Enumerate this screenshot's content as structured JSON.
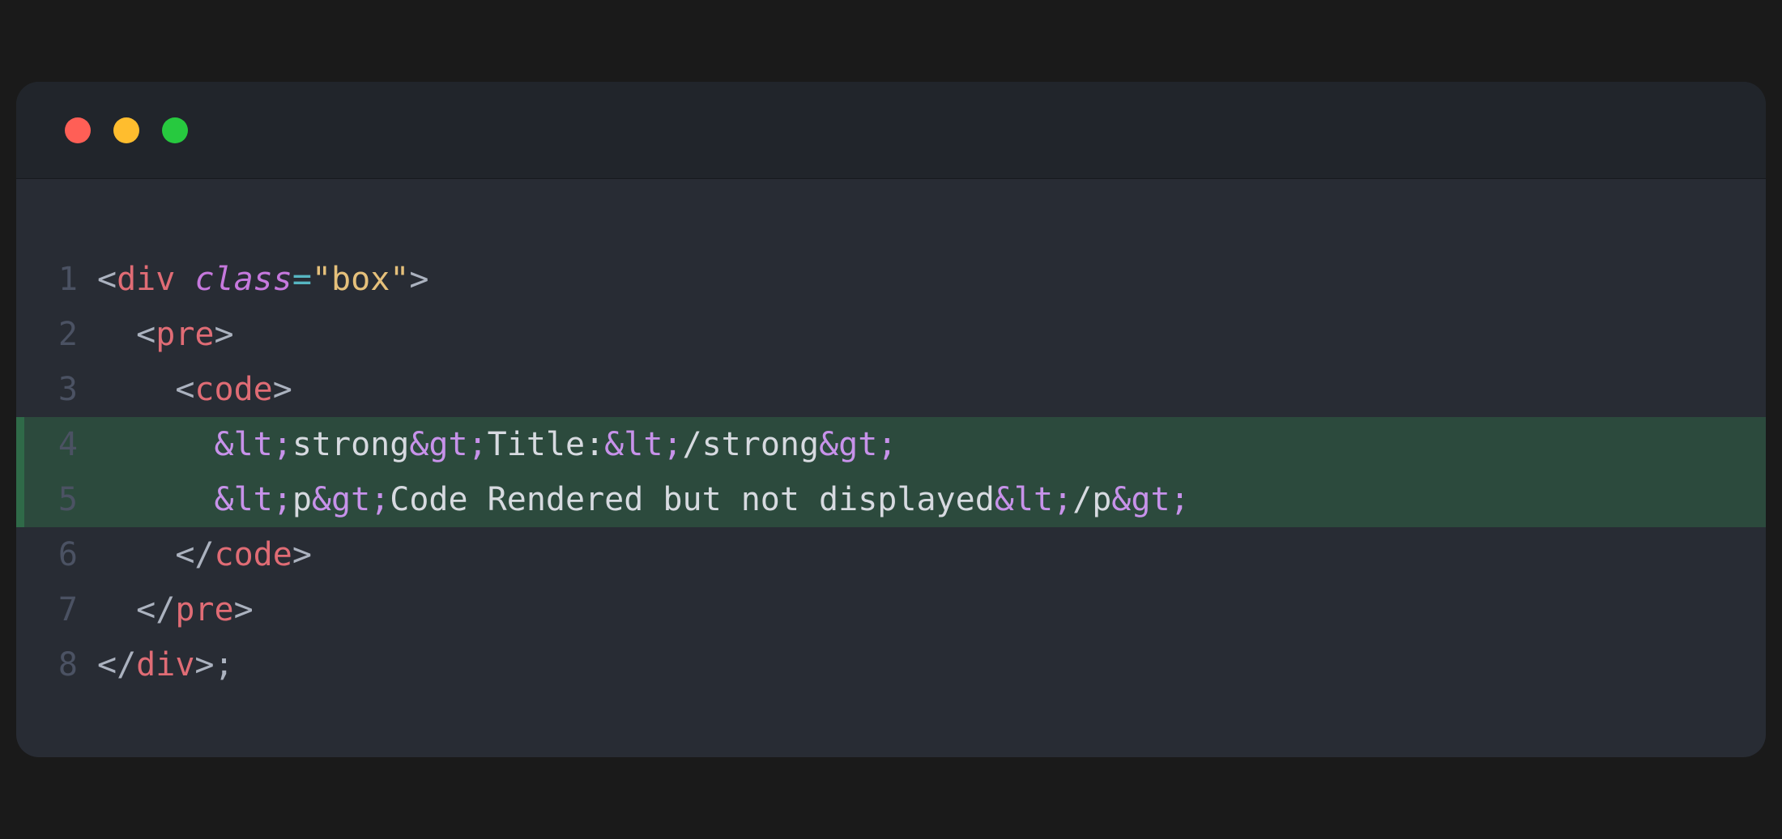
{
  "editor": {
    "lines": [
      {
        "num": "1",
        "highlight": false
      },
      {
        "num": "2",
        "highlight": false
      },
      {
        "num": "3",
        "highlight": false
      },
      {
        "num": "4",
        "highlight": true
      },
      {
        "num": "5",
        "highlight": true
      },
      {
        "num": "6",
        "highlight": false
      },
      {
        "num": "7",
        "highlight": false
      },
      {
        "num": "8",
        "highlight": false
      }
    ],
    "tokens": {
      "l1": {
        "open": "<",
        "tag": "div",
        "sp": " ",
        "attr": "class",
        "eq": "=",
        "val": "\"box\"",
        "close": ">"
      },
      "l2": {
        "indent": "  ",
        "open": "<",
        "tag": "pre",
        "close": ">"
      },
      "l3": {
        "indent": "    ",
        "open": "<",
        "tag": "code",
        "close": ">"
      },
      "l4": {
        "indent": "      ",
        "e1": "&lt;",
        "t1": "strong",
        "e2": "&gt;",
        "t2": "Title:",
        "e3": "&lt;",
        "t3": "/strong",
        "e4": "&gt;"
      },
      "l5": {
        "indent": "      ",
        "e1": "&lt;",
        "t1": "p",
        "e2": "&gt;",
        "t2": "Code Rendered but not displayed",
        "e3": "&lt;",
        "t3": "/p",
        "e4": "&gt;"
      },
      "l6": {
        "indent": "    ",
        "open": "</",
        "tag": "code",
        "close": ">"
      },
      "l7": {
        "indent": "  ",
        "open": "</",
        "tag": "pre",
        "close": ">"
      },
      "l8": {
        "open": "</",
        "tag": "div",
        "close": ">",
        "semi": ";"
      }
    }
  }
}
